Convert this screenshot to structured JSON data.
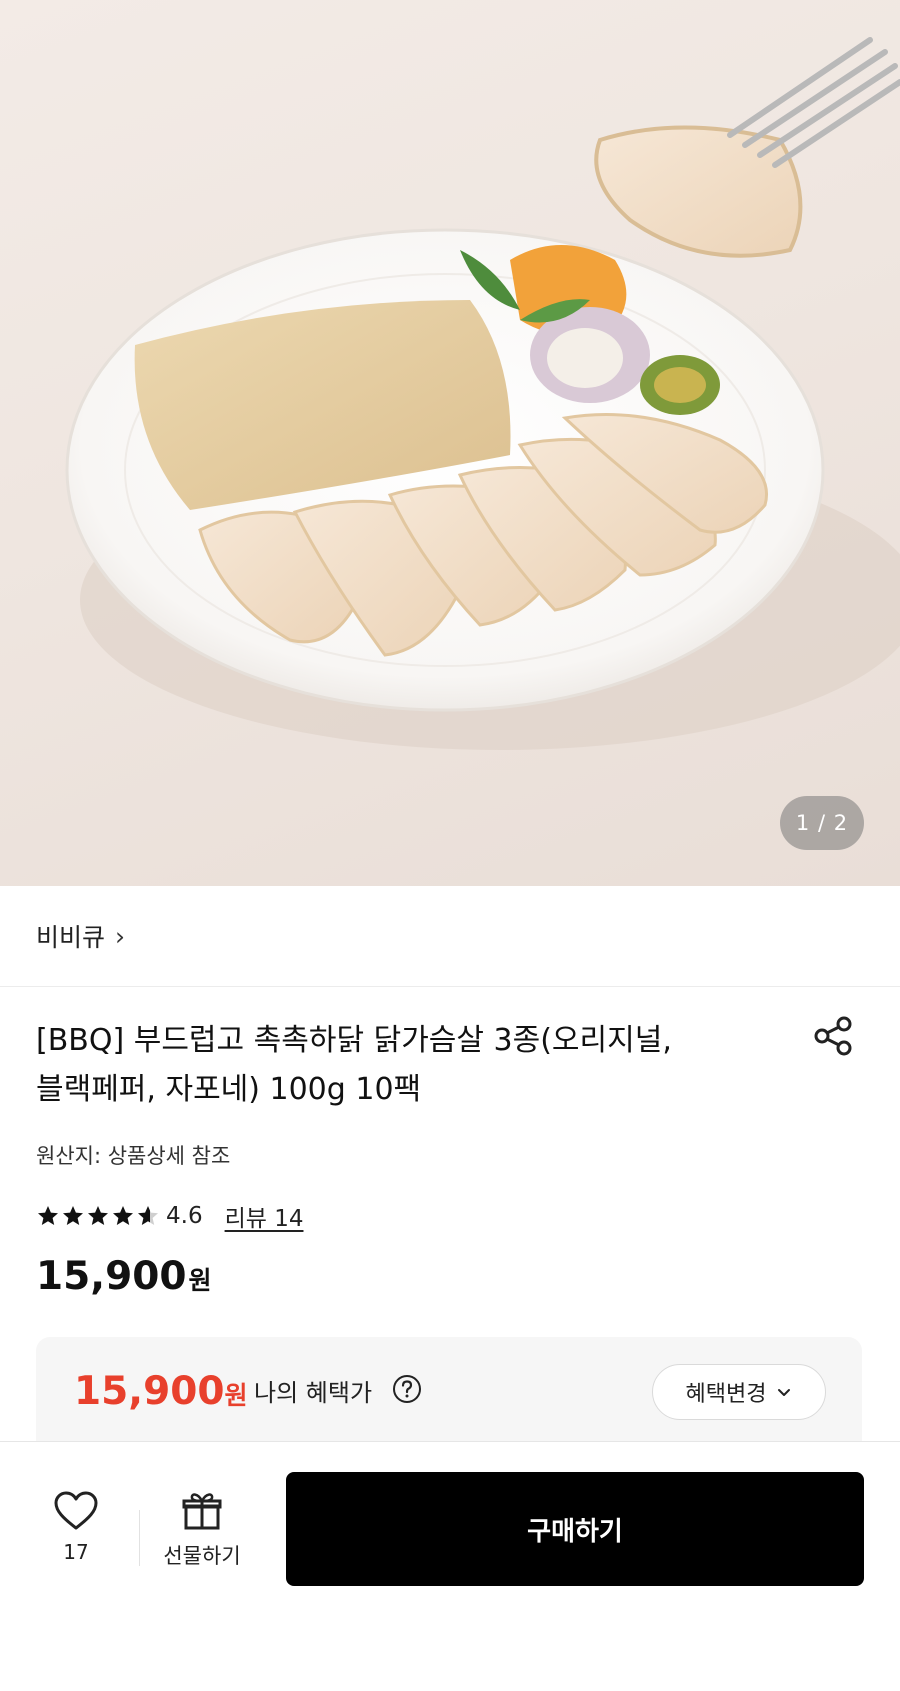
{
  "hero": {
    "image": "product-photo-chicken-breast-plate",
    "pager": "1 / 2"
  },
  "brand": {
    "name": "비비큐",
    "chevron": "›"
  },
  "product": {
    "title_line1": "[BBQ] 부드럽고 촉촉하닭 닭가슴살 3종(오리지널,",
    "title_line2": "블랙페퍼, 자포네) 100g 10팩",
    "origin": "원산지: 상품상세 참조",
    "rating": "4.6",
    "rating_value": 4.6,
    "reviews": "리뷰 14",
    "price": "15,900",
    "price_unit": "원",
    "share_icon": "share-icon"
  },
  "benefit": {
    "price": "15,900",
    "price_unit": "원",
    "label": "나의 혜택가",
    "change_label": "혜택변경",
    "accent_color": "#e8402c"
  },
  "bottom_bar": {
    "like_count": "17",
    "gift_label": "선물하기",
    "buy_label": "구매하기"
  }
}
